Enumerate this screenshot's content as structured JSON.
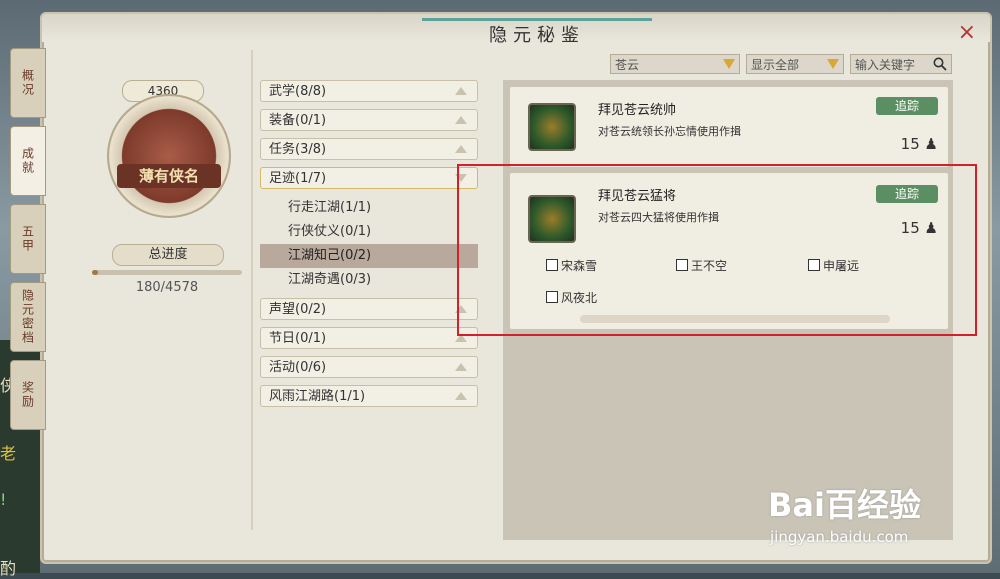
{
  "window": {
    "title": "隐元秘鉴",
    "close_label": "×"
  },
  "vertical_tabs": [
    {
      "label": "概况",
      "active": false
    },
    {
      "label": "成就",
      "active": true
    },
    {
      "label": "五甲",
      "active": false
    },
    {
      "label": "隐元密档",
      "active": false
    },
    {
      "label": "奖励",
      "active": false
    }
  ],
  "left_strip": {
    "text1": "侠",
    "text2": "老",
    "text3": "!",
    "text4": "酌"
  },
  "profile": {
    "coin_value": "4360",
    "title": "薄有侠名",
    "progress_label": "总进度",
    "progress_text": "180/4578",
    "progress_fraction": 0.039
  },
  "filters": {
    "school": "苍云",
    "display": "显示全部",
    "search_placeholder": "输入关键字"
  },
  "categories": [
    {
      "label": "武学(8/8)",
      "open": false
    },
    {
      "label": "装备(0/1)",
      "open": false
    },
    {
      "label": "任务(3/8)",
      "open": false
    },
    {
      "label": "足迹(1/7)",
      "open": true
    }
  ],
  "subcategories": [
    {
      "label": "行走江湖(1/1)",
      "active": false
    },
    {
      "label": "行侠仗义(0/1)",
      "active": false
    },
    {
      "label": "江湖知己(0/2)",
      "active": true
    },
    {
      "label": "江湖奇遇(0/3)",
      "active": false
    }
  ],
  "categories_after": [
    {
      "label": "声望(0/2)"
    },
    {
      "label": "节日(0/1)"
    },
    {
      "label": "活动(0/6)"
    },
    {
      "label": "风雨江湖路(1/1)"
    }
  ],
  "achievements": [
    {
      "name": "拜见苍云统帅",
      "desc": "对苍云统领长孙忘情使用作揖",
      "track_label": "追踪",
      "points": "15"
    },
    {
      "name": "拜见苍云猛将",
      "desc": "对苍云四大猛将使用作揖",
      "track_label": "追踪",
      "points": "15",
      "subitems": [
        "宋森雪",
        "王不空",
        "申屠远",
        "风夜北"
      ]
    }
  ],
  "watermark": {
    "main": "Bai百经验",
    "sub": "jingyan.baidu.com"
  },
  "colors": {
    "track_button": "#5b8f63",
    "highlight_box": "#d2212b",
    "close": "#b8352e"
  }
}
